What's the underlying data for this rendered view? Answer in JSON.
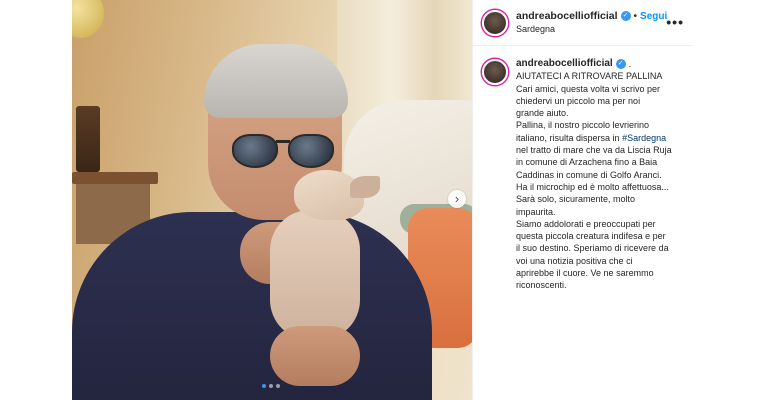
{
  "post": {
    "username": "andreabocelliofficial",
    "separator": "•",
    "follow_label": "Segui",
    "location": "Sardegna",
    "more_icon": "more-horizontal-icon",
    "more_label": "•••",
    "verified_mark": "✓",
    "carousel": {
      "current": 1,
      "total": 3,
      "next_label": "›"
    }
  },
  "caption": {
    "username": "andreabocelliofficial",
    "trailing": ".",
    "lines": [
      "AIUTATECI A RITROVARE PALLINA",
      "Cari amici, questa volta vi scrivo per",
      "chiedervi un piccolo ma per noi",
      "grande aiuto.",
      "Pallina, il nostro piccolo levrierino",
      "italiano, risulta dispersa in"
    ],
    "hashtag": "#Sardegna",
    "lines_after": [
      "nel tratto di mare che va da Liscia Ruja",
      "in comune di Arzachena fino a Baia",
      "Caddinas in comune di Golfo Aranci.",
      "Ha il microchip ed è molto affettuosa...",
      "Sarà solo, sicuramente, molto",
      "impaurita.",
      "Siamo addolorati e preoccupati per",
      "questa piccola creatura indifesa e per",
      "il suo destino. Speriamo di ricevere da",
      "voi una notizia positiva che ci",
      "aprirebbe il cuore. Ve ne saremmo",
      "riconoscenti."
    ]
  },
  "colors": {
    "accent_blue": "#0095f6",
    "hashtag": "#00376b",
    "text": "#262626",
    "divider": "#efefef"
  }
}
